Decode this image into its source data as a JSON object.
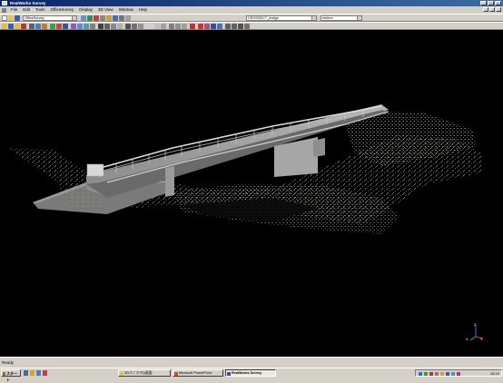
{
  "window": {
    "title": "RealWorks Survey"
  },
  "menu": [
    "File",
    "Edit",
    "Tools",
    "OfficeSurvey",
    "Display",
    "3D View",
    "Window",
    "Help"
  ],
  "toolbar": {
    "mode_combo": "OfficeSurvey",
    "project_combo": "CROSSECT_bridge",
    "units_combo": "meters"
  },
  "statusbar": {
    "text": "Ready"
  },
  "taskbar": {
    "start_label": "スタート",
    "tasks": [
      {
        "label": "3DパノラマQ画面",
        "active": false
      },
      {
        "label": "Microsoft PowerPoint",
        "active": false
      },
      {
        "label": "RealWorks Survey",
        "active": true
      }
    ],
    "clock": "15:24"
  },
  "axis_gizmo": {
    "x": "X",
    "y": "Y",
    "z": "Z"
  },
  "colors": {
    "title_start": "#0a246a",
    "title_end": "#3a6ea5",
    "chrome": "#d4d0c8",
    "viewport": "#000000"
  }
}
